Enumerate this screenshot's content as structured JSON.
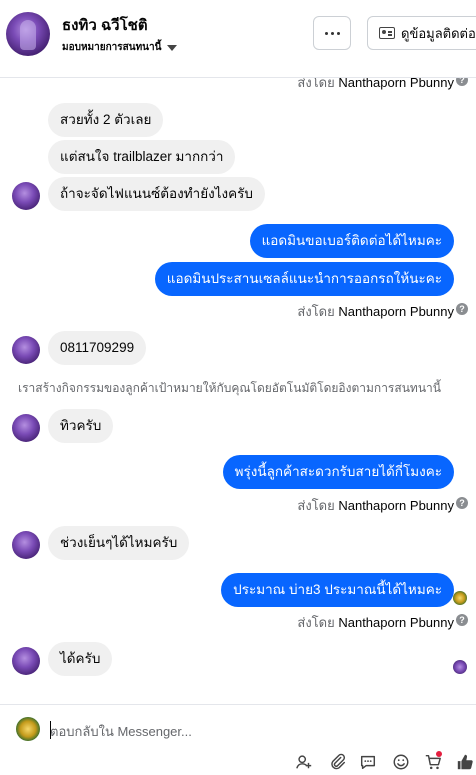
{
  "header": {
    "contact_name": "ธงทิว ฉวีโชติ",
    "assign_label": "มอบหมายการสนทนานี้",
    "more_label": "…",
    "detail_button": "ดูข้อมูลติดต่อ"
  },
  "thread": {
    "sent_by_prefix": "ส่งโดย",
    "sender": "Nanthaporn Pbunny",
    "messages": [
      {
        "dir": "in",
        "text": "สวยทั้ง 2 ตัวเลย"
      },
      {
        "dir": "in",
        "text": "แต่สนใจ trailblazer มากกว่า"
      },
      {
        "dir": "in",
        "text": "ถ้าจะจัดไฟแนนซ์ต้องทำยังไงครับ"
      },
      {
        "dir": "out",
        "text": "แอดมินขอเบอร์ติดต่อได้ไหมคะ"
      },
      {
        "dir": "out",
        "text": "แอดมินประสานเซลล์แนะนำการออกรถให้นะคะ"
      },
      {
        "dir": "in",
        "text": "0811709299"
      },
      {
        "dir": "in",
        "text": "ทิวครับ"
      },
      {
        "dir": "out",
        "text": "พรุ่งนี้ลูกค้าสะดวกรับสายได้กี่โมงคะ"
      },
      {
        "dir": "in",
        "text": "ช่วงเย็นๆได้ไหมครับ"
      },
      {
        "dir": "out",
        "text": "ประมาณ บ่าย3 ประมาณนี้ได้ไหมคะ"
      },
      {
        "dir": "in",
        "text": "ได้ครับ"
      }
    ],
    "system_note": "เราสร้างกิจกรรมของลูกค้าเป้าหมายให้กับคุณโดยอัตโนมัติโดยอิงตามการสนทนานี้"
  },
  "composer": {
    "placeholder": "ตอบกลับใน Messenger..."
  },
  "colors": {
    "outgoing_bubble": "#0866ff",
    "incoming_bubble": "#f0f0f0",
    "secondary_text": "#65676b"
  },
  "icons": [
    "add-contact-icon",
    "attach-icon",
    "saved-replies-icon",
    "emoji-icon",
    "cart-icon",
    "like-icon"
  ]
}
